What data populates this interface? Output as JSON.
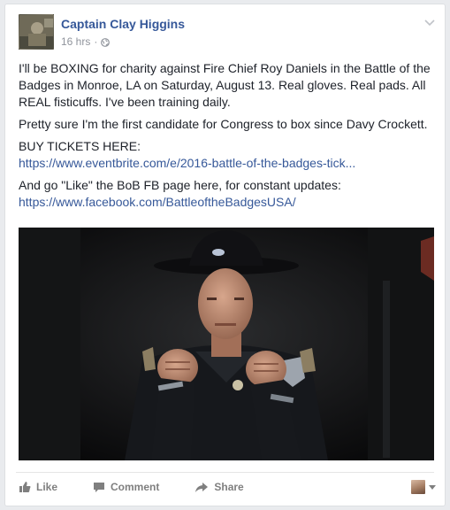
{
  "post": {
    "author": "Captain Clay Higgins",
    "time": "16 hrs",
    "paragraphs": [
      "I'll be BOXING for charity against Fire Chief Roy Daniels in the Battle of the Badges in Monroe, LA on Saturday, August 13. Real gloves. Real pads. All REAL fisticuffs. I've been training daily.",
      "Pretty sure I'm the first candidate for Congress to box since Davy Crockett."
    ],
    "tickets_label": "BUY TICKETS HERE:",
    "tickets_link": "https://www.eventbrite.com/e/2016-battle-of-the-badges-tick...",
    "like_page_text": "And go \"Like\" the BoB FB page here, for constant updates:",
    "like_page_link": "https://www.facebook.com/BattleoftheBadgesUSA/"
  },
  "actions": {
    "like": "Like",
    "comment": "Comment",
    "share": "Share"
  },
  "icons": {
    "privacy": "globe-icon",
    "menu": "chevron-down-icon",
    "like": "thumbs-up-icon",
    "comment": "comment-bubble-icon",
    "share": "share-arrow-icon"
  },
  "colors": {
    "link": "#365899",
    "text": "#1d2129",
    "meta": "#90949c",
    "background": "#e9ebee"
  }
}
